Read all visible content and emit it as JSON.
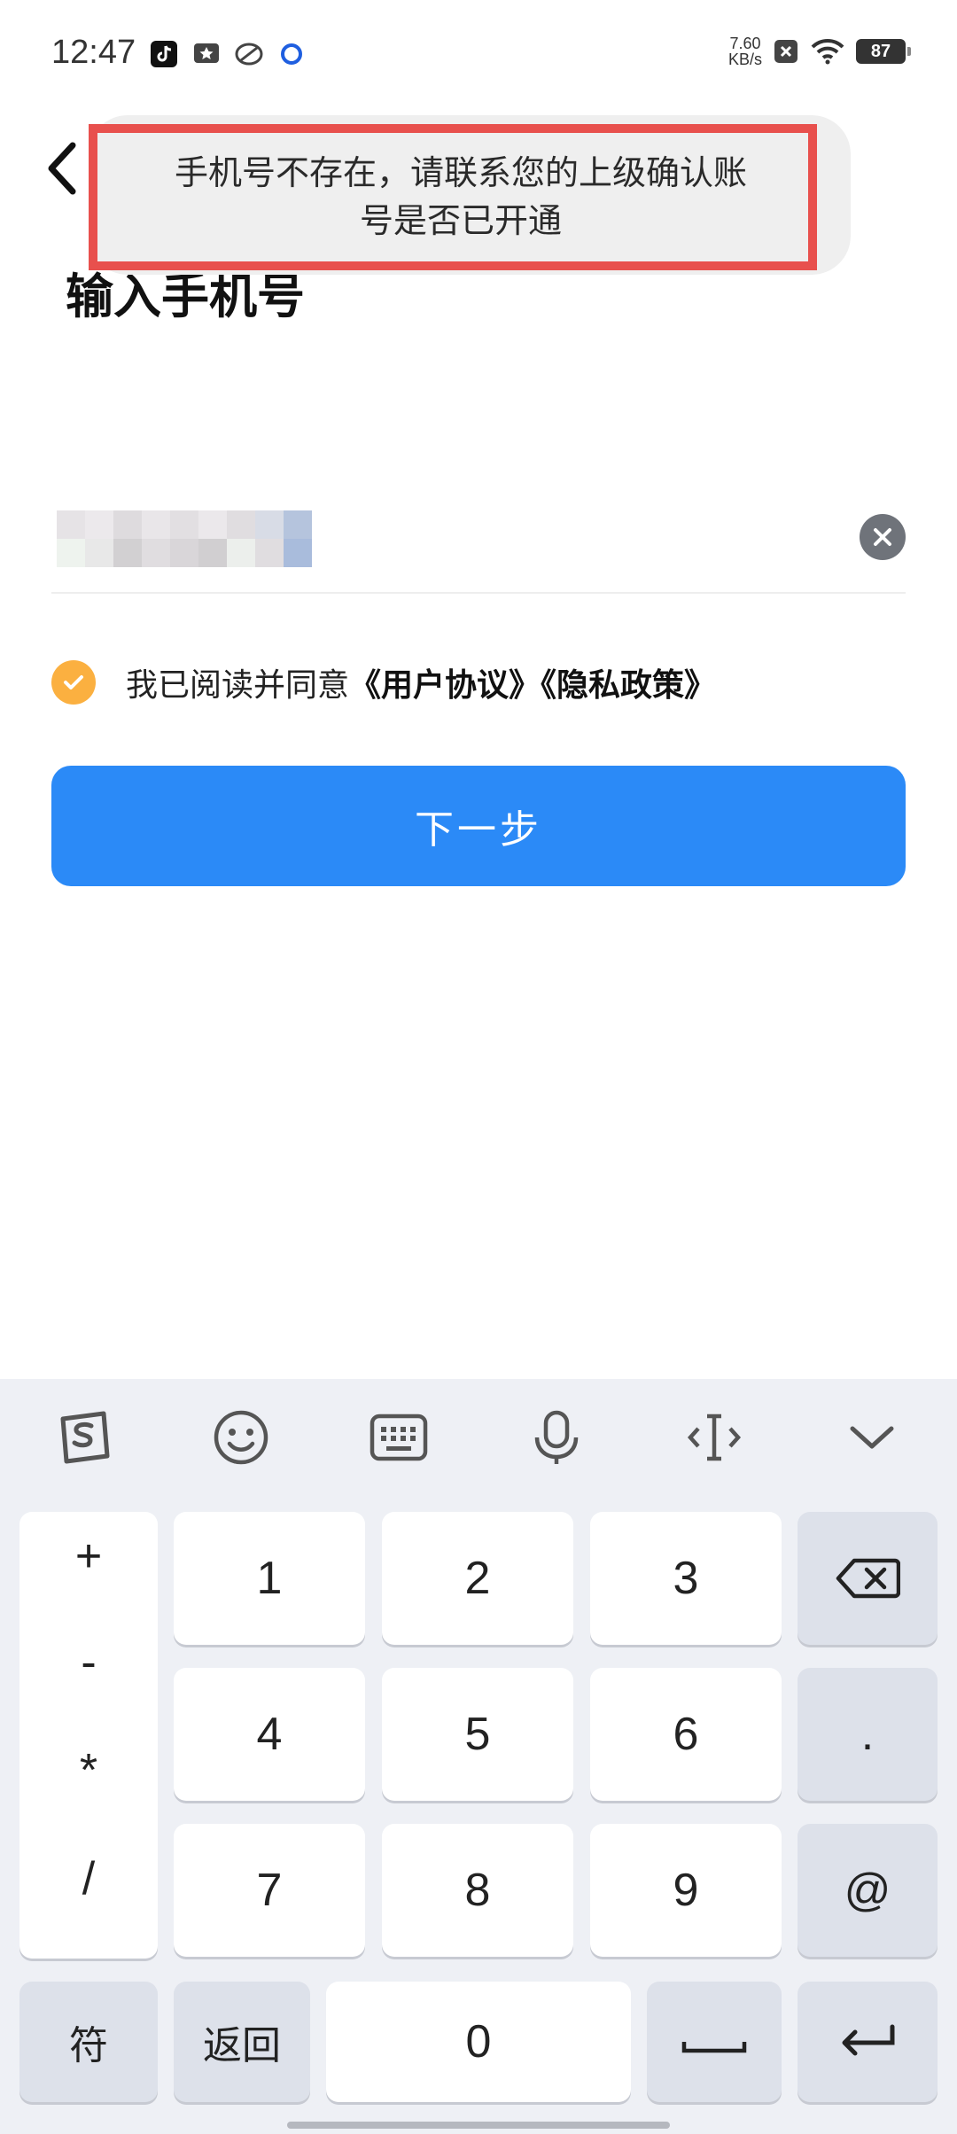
{
  "status": {
    "time": "12:47",
    "net_speed_value": "7.60",
    "net_speed_unit": "KB/s",
    "battery": "87"
  },
  "toast": {
    "line1": "手机号不存在，请联系您的上级确认账",
    "line2": "号是否已开通"
  },
  "page": {
    "title": "输入手机号"
  },
  "agreement": {
    "prefix": "我已阅读并同意",
    "terms": "《用户协议》",
    "privacy": "《隐私政策》"
  },
  "next_button": "下一步",
  "keyboard": {
    "symbols": [
      "+",
      "-",
      "*",
      "/"
    ],
    "digits": [
      "1",
      "2",
      "3",
      "4",
      "5",
      "6",
      "7",
      "8",
      "9",
      "0"
    ],
    "dot": ".",
    "at": "@",
    "fu": "符",
    "back": "返回"
  },
  "colors": {
    "accent": "#2b8af7",
    "check": "#fbb040",
    "highlight": "#e8504d"
  }
}
